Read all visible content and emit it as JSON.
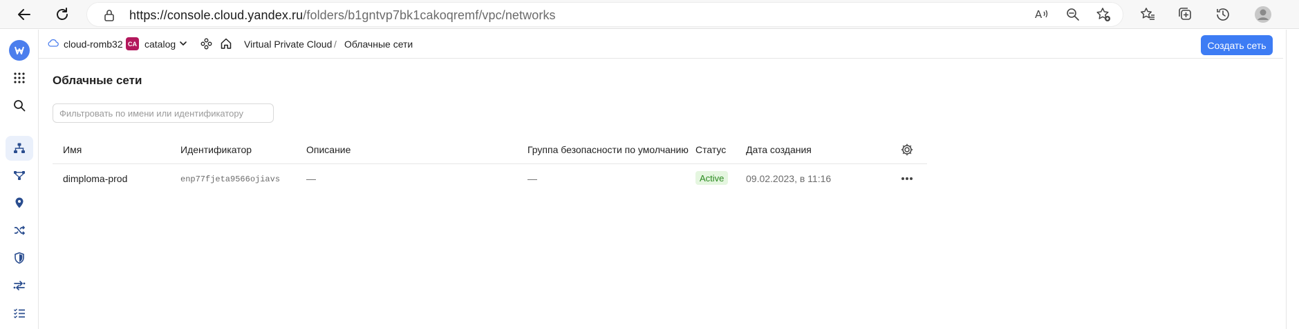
{
  "browser": {
    "url_host": "https://console.cloud.yandex.ru",
    "url_path": "/folders/b1gntvp7bk1cakoqremf/vpc/networks"
  },
  "header": {
    "cloud": "cloud-romb32",
    "folder_badge": "CA",
    "folder": "catalog",
    "breadcrumb_service": "Virtual Private Cloud",
    "breadcrumb_sep": "/",
    "breadcrumb_current": "Облачные сети",
    "create_button": "Создать сеть"
  },
  "main": {
    "title": "Облачные сети",
    "filter_placeholder": "Фильтровать по имени или идентификатору",
    "columns": [
      "Имя",
      "Идентификатор",
      "Описание",
      "Группа безопасности по умолчанию",
      "Статус",
      "Дата создания"
    ],
    "rows": [
      {
        "name": "dimploma-prod",
        "id": "enp77fjeta9566ojiavs",
        "description": "—",
        "security_group": "—",
        "status": "Active",
        "created": "09.02.2023, в 11:16"
      }
    ]
  },
  "colors": {
    "accent": "#3d7cf4",
    "logo": "#4b7eed",
    "folder_badge": "#b3185c",
    "status_active_bg": "#e5f6e0",
    "status_active_text": "#2a8a1f"
  }
}
